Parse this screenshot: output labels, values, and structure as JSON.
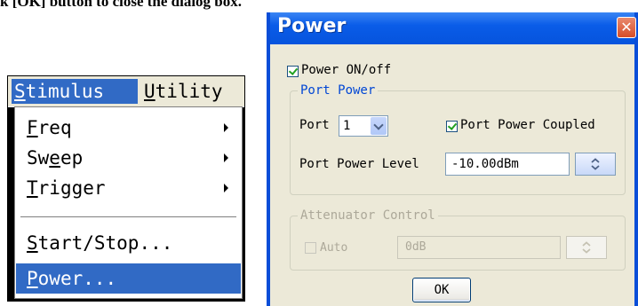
{
  "caption": "k [OK] button to close the dialog box.",
  "menubar": {
    "items": [
      {
        "label": "Stimulus",
        "mnemonic": "S",
        "rest": "timulus"
      },
      {
        "label": "Utility",
        "mnemonic": "U",
        "rest": "tility"
      }
    ]
  },
  "dropdown": {
    "items": [
      {
        "label": "Freq",
        "mnemonic": "F",
        "rest": "req"
      },
      {
        "label": "Sweep",
        "pre": "Sw",
        "mnemonic": "e",
        "rest": "ep"
      },
      {
        "label": "Trigger",
        "mnemonic": "T",
        "rest": "rigger"
      },
      {
        "label": "Start/Stop...",
        "mnemonic": "S",
        "rest": "tart/Stop..."
      },
      {
        "label": "Power...",
        "mnemonic": "P",
        "rest": "ower..."
      }
    ]
  },
  "dialog": {
    "title": "Power",
    "close_glyph": "✕",
    "power_on_label": "Power ON/off",
    "port_power": {
      "legend": "Port Power",
      "port_label": "Port",
      "port_value": "1",
      "coupled_label": "Port Power Coupled",
      "level_label": "Port Power Level",
      "level_value": "-10.00dBm"
    },
    "attenuator": {
      "legend": "Attenuator Control",
      "auto_label": "Auto",
      "value": "0dB"
    },
    "ok_label": "OK"
  },
  "colors": {
    "selection": "#316ac5",
    "title_blue": "#0a5ce8",
    "dialog_bg": "#ece9d8",
    "group_legend": "#0046d5"
  }
}
